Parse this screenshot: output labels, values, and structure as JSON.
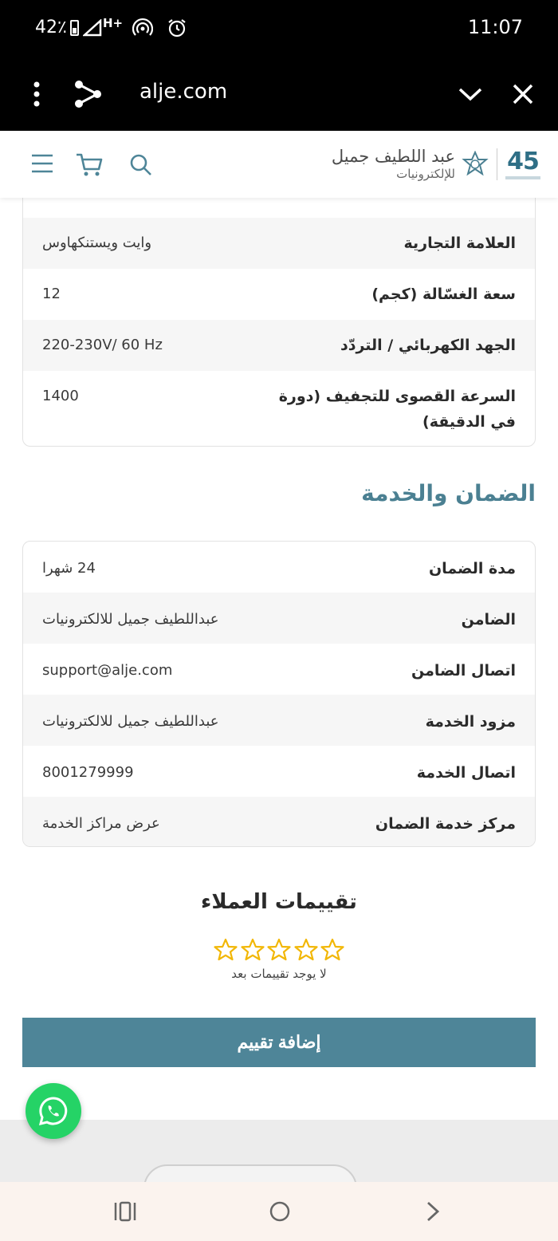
{
  "status_bar": {
    "battery": "42٪",
    "network": "H+",
    "time": "11:07"
  },
  "browser": {
    "url": "alje.com"
  },
  "header": {
    "brand_line1": "عبد اللطيف جميل",
    "brand_line2": "للإلكترونيات",
    "anniversary": "45"
  },
  "specs": {
    "partial_row": "",
    "rows": [
      {
        "label": "العلامة التجارية",
        "value": "وايت ويستنكهاوس"
      },
      {
        "label": "سعة الغسّالة (كجم)",
        "value": "12"
      },
      {
        "label": "الجهد الكهربائي / التردّد",
        "value": "220-230V/ 60 Hz"
      },
      {
        "label": "السرعة القصوى للتجفيف (دورة في الدقيقة)",
        "value": "1400"
      }
    ]
  },
  "warranty": {
    "title": "الضمان والخدمة",
    "rows": [
      {
        "label": "مدة الضمان",
        "value": "24 شهرا"
      },
      {
        "label": "الضامن",
        "value": "عبداللطيف جميل للالكترونيات"
      },
      {
        "label": "اتصال الضامن",
        "value": "support@alje.com"
      },
      {
        "label": "مزود الخدمة",
        "value": "عبداللطيف جميل للالكترونيات"
      },
      {
        "label": "اتصال الخدمة",
        "value": "8001279999"
      },
      {
        "label": "مركز خدمة الضمان",
        "value": "عرض مراكز الخدمة"
      }
    ]
  },
  "reviews": {
    "title": "تقييمات العملاء",
    "rating": 0,
    "max_rating": 5,
    "empty_text": "لا يوجد تقييمات بعد",
    "add_button": "إضافة تقييم"
  },
  "colors": {
    "accent": "#4e8598",
    "title": "#4b8092",
    "star": "#f2b705",
    "whatsapp": "#25d366"
  },
  "icons": [
    "menu-dots-icon",
    "share-icon",
    "chevron-down-icon",
    "close-icon",
    "hamburger-icon",
    "cart-icon",
    "search-icon",
    "star-icon",
    "whatsapp-icon",
    "recents-icon",
    "home-icon",
    "back-icon"
  ]
}
